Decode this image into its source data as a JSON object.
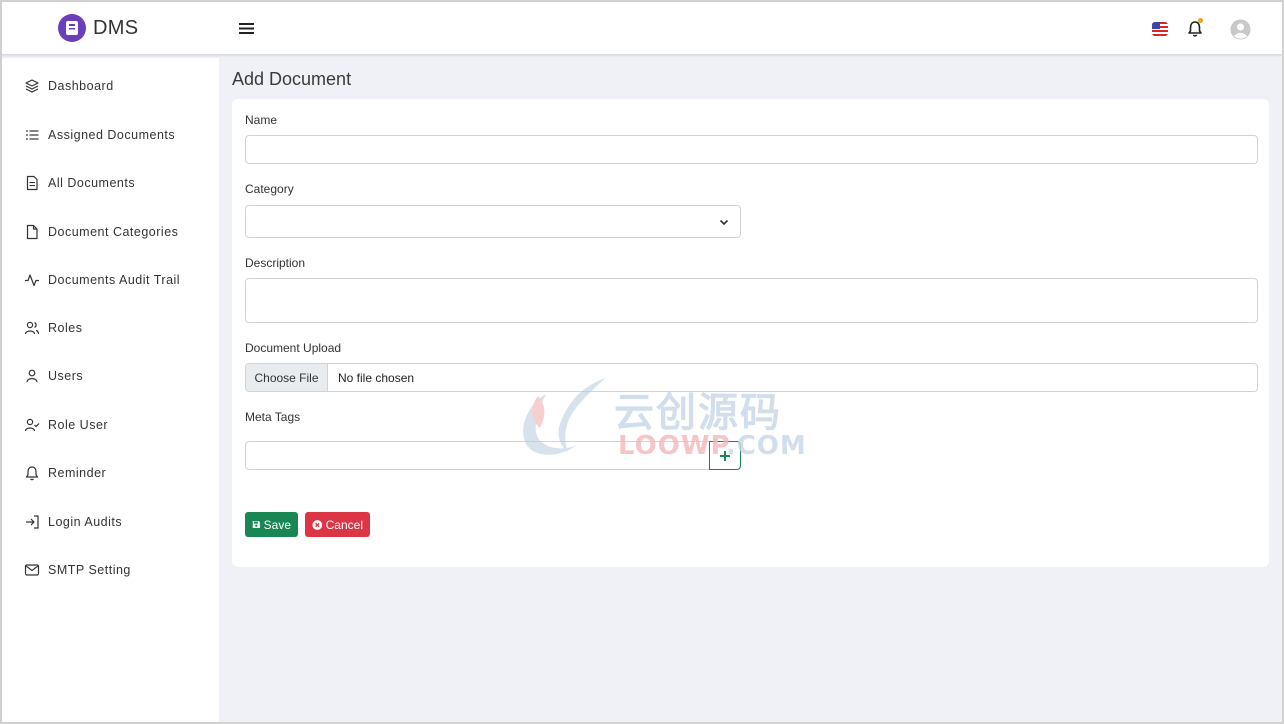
{
  "app": {
    "name": "DMS"
  },
  "sidebar": {
    "items": [
      {
        "label": "Dashboard",
        "icon": "layers-icon"
      },
      {
        "label": "Assigned Documents",
        "icon": "list-icon"
      },
      {
        "label": "All Documents",
        "icon": "file-text-icon"
      },
      {
        "label": "Document Categories",
        "icon": "file-icon"
      },
      {
        "label": "Documents Audit Trail",
        "icon": "activity-icon"
      },
      {
        "label": "Roles",
        "icon": "users-icon"
      },
      {
        "label": "Users",
        "icon": "user-icon"
      },
      {
        "label": "Role User",
        "icon": "user-check-icon"
      },
      {
        "label": "Reminder",
        "icon": "bell-icon"
      },
      {
        "label": "Login Audits",
        "icon": "log-in-icon"
      },
      {
        "label": "SMTP Setting",
        "icon": "mail-icon"
      }
    ]
  },
  "page": {
    "title": "Add Document"
  },
  "form": {
    "name_label": "Name",
    "name_value": "",
    "category_label": "Category",
    "category_value": "",
    "description_label": "Description",
    "description_value": "",
    "upload_label": "Document Upload",
    "upload_button": "Choose File",
    "upload_status": "No file chosen",
    "meta_label": "Meta Tags",
    "meta_value": "",
    "save_label": "Save",
    "cancel_label": "Cancel"
  },
  "watermark": {
    "text_cn": "云创源码",
    "text_en_a": "LOOWP",
    "text_en_b": ".COM"
  },
  "colors": {
    "brand": "#6b3fb8",
    "save": "#198754",
    "cancel": "#dc3545",
    "notify_dot": "#f0a020"
  }
}
